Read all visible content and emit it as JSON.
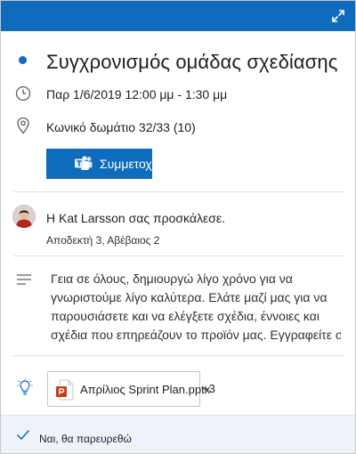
{
  "colors": {
    "accent": "#0f6cbd",
    "footer_bg": "#eef3fa"
  },
  "event": {
    "title": "Συγχρονισμός ομάδας σχεδίασης",
    "datetime": "Παρ 1/6/2019 12:00 μμ - 1:30 μμ",
    "location": "Κωνικό δωμάτιο 32/33 (10)",
    "join_label": "Συμμετοχή"
  },
  "organizer": {
    "invite_text": "Η Kat Larsson σας προσκάλεσε.",
    "response_summary": "Αποδεκτή 3, Αβέβαιος 2"
  },
  "description": {
    "lines": [
      "Γεια σε όλους, δημιουργώ λίγο χρόνο για να",
      "γνωριστούμε λίγο καλύτερα. Ελάτε μαζί μας για να",
      "παρουσιάσετε και να ελέγξετε σχέδια, έννοιες και",
      "σχέδια που επηρεάζουν το προϊόν μας. Εγγραφείτε στο…"
    ]
  },
  "attachments": {
    "first_name": "Απρίλιος Sprint Plan.pptx",
    "more_count": "+3"
  },
  "rsvp": {
    "status_label": "Ναι, θα παρευρεθώ"
  },
  "icons": {
    "expand": "expand-icon",
    "clock": "clock-icon",
    "location": "location-pin-icon",
    "teams": "teams-icon",
    "description": "text-lines-icon",
    "lightbulb": "lightbulb-icon",
    "powerpoint": "powerpoint-file-icon",
    "check": "checkmark-icon"
  }
}
